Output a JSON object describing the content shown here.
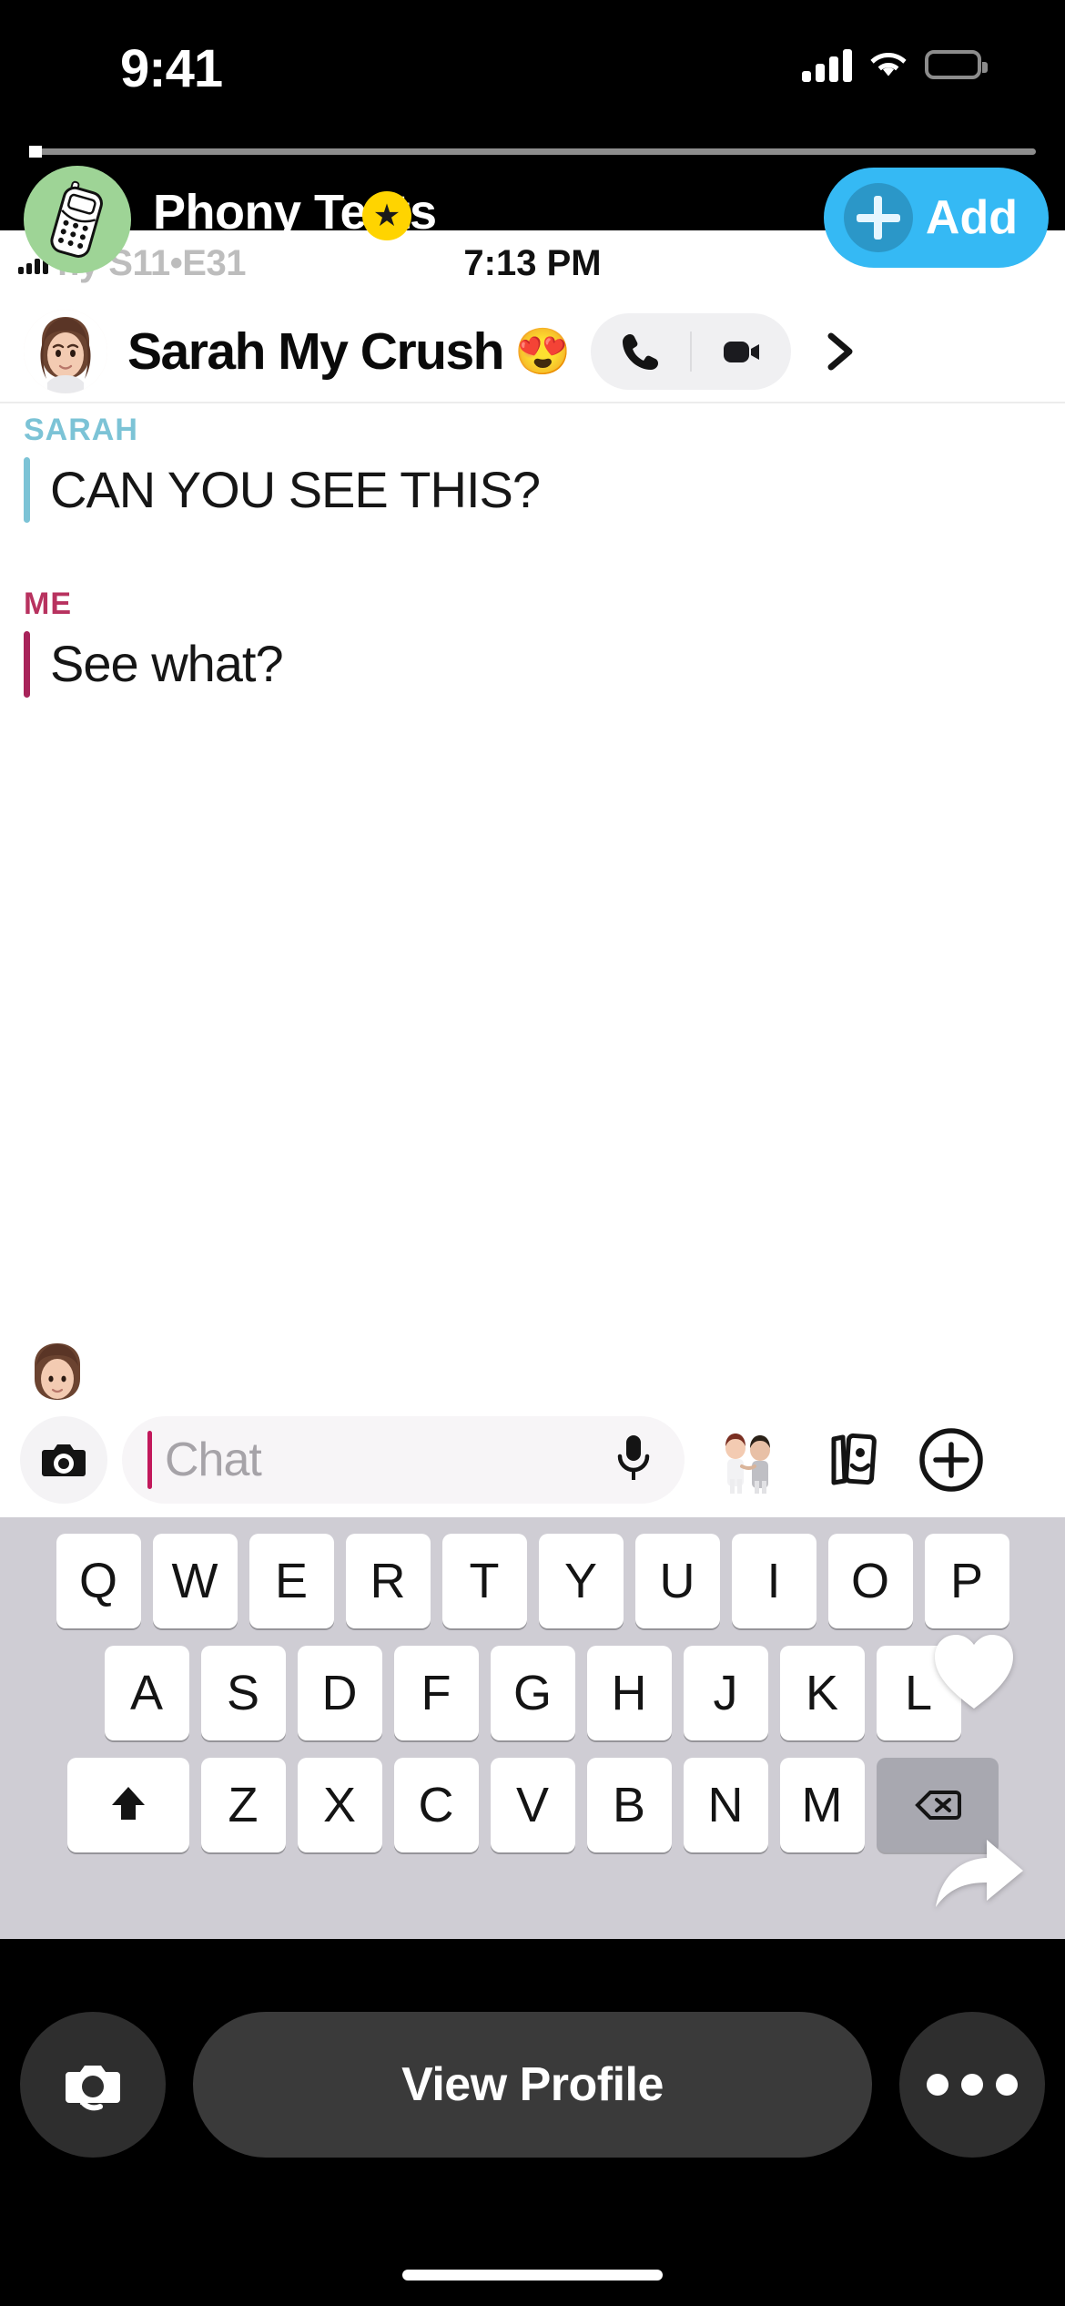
{
  "ios_status": {
    "time": "9:41",
    "signal_icon": "cellular-signal-icon",
    "wifi_icon": "wifi-icon",
    "battery_icon": "battery-icon"
  },
  "brand": {
    "title": "Phony Texts",
    "star_glyph": "★",
    "avatar_icon": "flip-phone-icon",
    "add_label": "Add",
    "accent_blue": "#35b9f4",
    "avatar_green": "#9ed496",
    "star_yellow": "#ffd400"
  },
  "fake_status": {
    "carrier": "ny S11•E31",
    "clock": "7:13 PM"
  },
  "conversation": {
    "name": "Sarah My Crush",
    "name_emoji": "😍",
    "avatar_icon": "sarah-avatar-icon",
    "phone_icon": "phone-call-icon",
    "video_icon": "video-call-icon",
    "chevron_icon": "chevron-right-icon",
    "messages": [
      {
        "from": "SARAH",
        "side": "sarah",
        "text": "CAN YOU SEE THIS?",
        "accent": "#7cc3d6"
      },
      {
        "from": "ME",
        "side": "me",
        "text": "See what?",
        "accent": "#a8235a"
      }
    ]
  },
  "chatbar": {
    "sender_bitmoji_icon": "sender-bitmoji-icon",
    "camera_icon": "camera-icon",
    "placeholder": "Chat",
    "caret_color": "#c2185b",
    "mic_icon": "microphone-icon",
    "friendmoji_icon": "friendmoji-icon",
    "stickers_icon": "sticker-cards-icon",
    "plus_icon": "plus-circle-icon"
  },
  "keyboard": {
    "row1": [
      "Q",
      "W",
      "E",
      "R",
      "T",
      "Y",
      "U",
      "I",
      "O",
      "P"
    ],
    "row2": [
      "A",
      "S",
      "D",
      "F",
      "G",
      "H",
      "J",
      "K",
      "L"
    ],
    "row3": [
      "Z",
      "X",
      "C",
      "V",
      "B",
      "N",
      "M"
    ],
    "shift_icon": "shift-arrow-icon",
    "backspace_icon": "backspace-delete-icon",
    "overlay_heart_icon": "heart-overlay-icon",
    "overlay_arrow_icon": "forward-arrow-overlay-icon"
  },
  "bottom_bar": {
    "camera_flip_icon": "camera-flip-icon",
    "view_profile_label": "View Profile",
    "more_icon": "more-dots-icon"
  }
}
